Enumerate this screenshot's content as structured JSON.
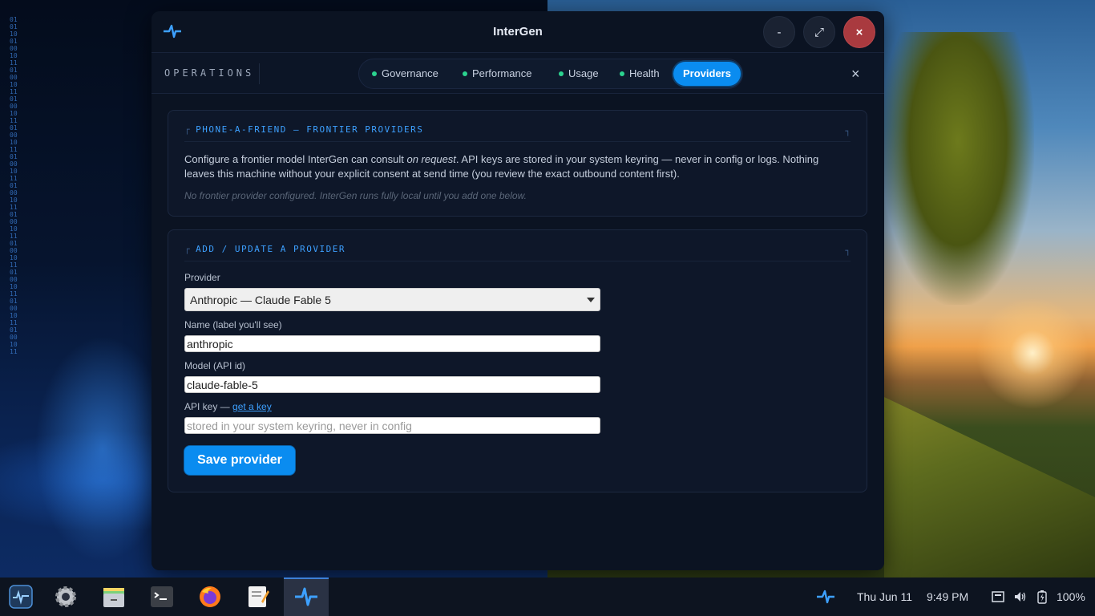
{
  "window": {
    "title": "InterGen",
    "controls": {
      "minimize": "-",
      "maximize": "⤢",
      "close": "×"
    }
  },
  "nav": {
    "section_label": "OPERATIONS",
    "tabs": [
      {
        "label": "Governance",
        "status": "green"
      },
      {
        "label": "Performance",
        "status": "green"
      },
      {
        "label": "Usage",
        "status": "green"
      },
      {
        "label": "Health",
        "status": "green"
      },
      {
        "label": "Providers",
        "active": true
      }
    ],
    "close": "×"
  },
  "frontier_card": {
    "heading": "PHONE-A-FRIEND — FRONTIER PROVIDERS",
    "desc_part1": "Configure a frontier model InterGen can consult ",
    "desc_emphasis": "on request",
    "desc_part2": ". API keys are stored in your system keyring — never in config or logs. Nothing leaves this machine without your explicit consent at send time (you review the exact outbound content first).",
    "empty_note": "No frontier provider configured. InterGen runs fully local until you add one below."
  },
  "form": {
    "heading": "ADD / UPDATE A PROVIDER",
    "provider_label": "Provider",
    "provider_value": "Anthropic — Claude Fable 5",
    "name_label": "Name (label you'll see)",
    "name_value": "anthropic",
    "model_label": "Model (API id)",
    "model_value": "claude-fable-5",
    "apikey_label": "API key — ",
    "apikey_link": "get a key",
    "apikey_placeholder": "stored in your system keyring, never in config",
    "save_label": "Save provider"
  },
  "taskbar": {
    "apps": [
      "activity-monitor",
      "settings",
      "files",
      "terminal",
      "firefox",
      "text-editor",
      "intergen"
    ],
    "date": "Thu Jun 11",
    "time": "9:49 PM",
    "battery": "100%"
  },
  "colors": {
    "accent": "#0a8cf0",
    "status_dot": "#2bd38f",
    "close_button": "#a93a3f"
  }
}
